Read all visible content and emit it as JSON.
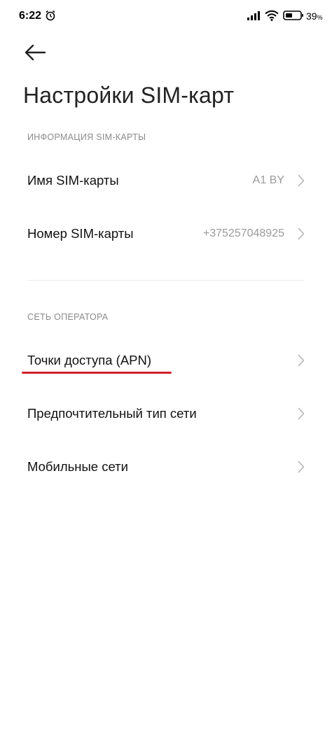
{
  "status_bar": {
    "time": "6:22",
    "battery_level": "39",
    "battery_unit": "%",
    "icons": [
      "alarm-icon",
      "signal-icon",
      "wifi-icon",
      "battery-icon"
    ]
  },
  "header": {
    "back_icon": "arrow-left-icon",
    "title": "Настройки SIM-карт"
  },
  "sections": [
    {
      "header": "ИНФОРМАЦИЯ SIM-КАРТЫ",
      "items": [
        {
          "label": "Имя SIM-карты",
          "value": "A1 BY"
        },
        {
          "label": "Номер SIM-карты",
          "value": "+375257048925"
        }
      ]
    },
    {
      "header": "СЕТЬ ОПЕРАТОРА",
      "items": [
        {
          "label": "Точки доступа (APN)",
          "value": ""
        },
        {
          "label": "Предпочтительный тип сети",
          "value": ""
        },
        {
          "label": "Мобильные сети",
          "value": ""
        }
      ]
    }
  ],
  "colors": {
    "highlight_underline": "#d3202a",
    "secondary_text": "#9a9a9a",
    "section_header": "#8a8a8a"
  }
}
